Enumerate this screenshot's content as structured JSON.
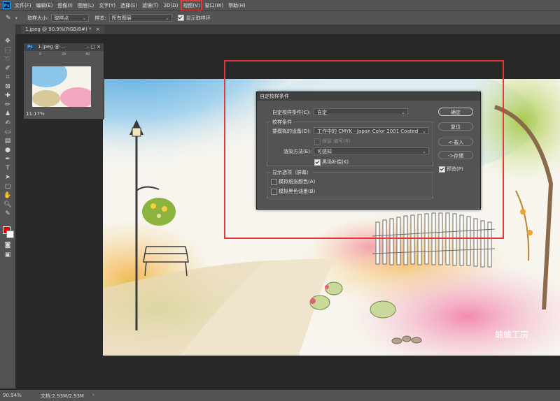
{
  "menu": {
    "items": [
      "文件(F)",
      "编辑(E)",
      "图像(I)",
      "图层(L)",
      "文字(Y)",
      "选择(S)",
      "滤镜(T)",
      "3D(D)",
      "视图(V)",
      "窗口(W)",
      "帮助(H)"
    ],
    "active_index": 8
  },
  "options": {
    "sample_size_label": "取样大小:",
    "sample_size_value": "取样点",
    "sample_label": "样本:",
    "sample_value": "所有图层",
    "show_ring_label": "显示取样环"
  },
  "document": {
    "tab_label": "1.jpeg @ 90.9%(RGB/8#) *"
  },
  "navigator": {
    "title": "1.jpeg @ ...",
    "zoom": "11.17%",
    "ruler_ticks": [
      "0",
      "20",
      "40"
    ]
  },
  "dialog": {
    "title": "自定校样条件",
    "custom_condition_label": "自定校样条件(C):",
    "custom_condition_value": "自定",
    "group_label": "校样条件",
    "device_label": "要模拟的设备(D):",
    "device_value": "工作中的 CMYK - Japan Color 2001 Coated",
    "preserve_numbers_label": "保留 编号(R)",
    "rendering_intent_label": "渲染方法(E):",
    "rendering_intent_value": "可感知",
    "black_point_label": "黑场补偿(K)",
    "display_group_label": "显示选项（屏幕）",
    "paper_color_label": "模拟纸张颜色(A)",
    "black_ink_label": "模拟黑色油墨(B)",
    "ok_label": "确定",
    "reset_label": "复位",
    "load_label": "<-载入",
    "save_label": "->存储",
    "preview_label": "预览(P)"
  },
  "watermark": "蛐蛐工房",
  "status": {
    "zoom": "90.94%",
    "doc_info": "文档:2.93M/2.93M"
  },
  "colors": {
    "highlight": "#e23a3a",
    "foreground": "#e00000",
    "background": "#ffffff"
  }
}
